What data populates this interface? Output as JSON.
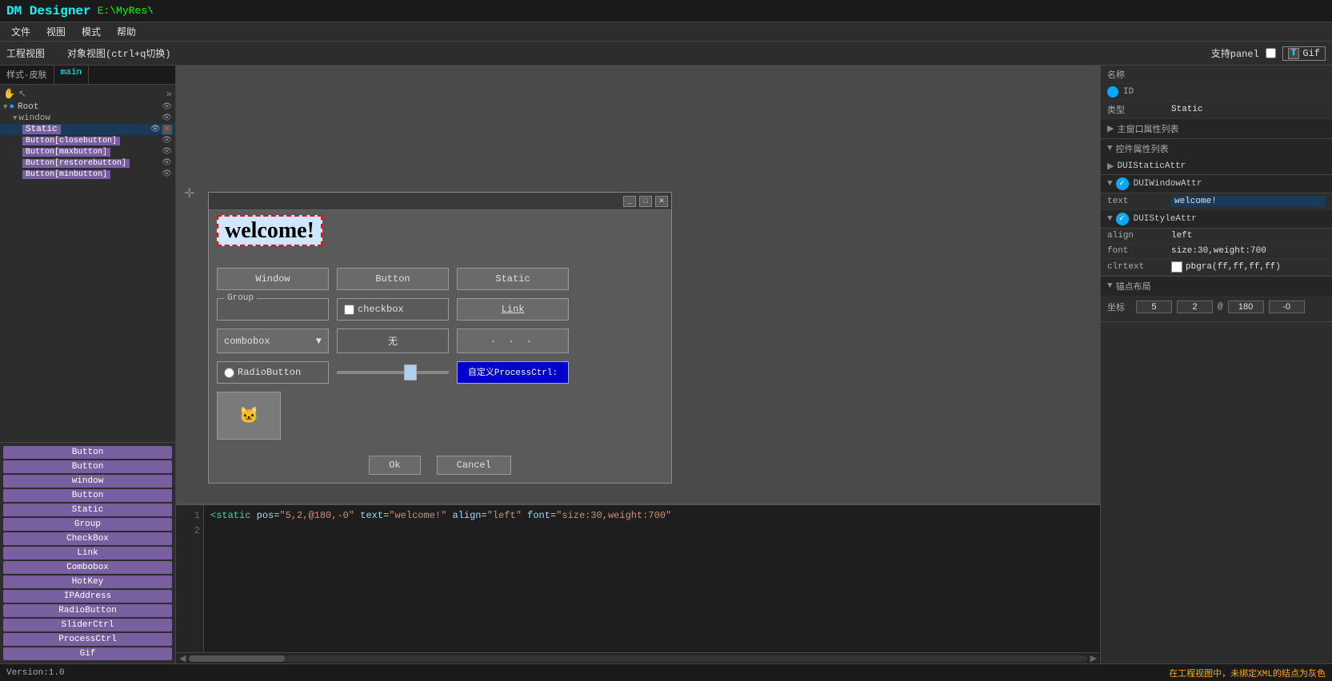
{
  "titleBar": {
    "appName": "DM Designer",
    "path": "E:\\MyRes\\"
  },
  "menuBar": {
    "items": [
      "文件",
      "视图",
      "模式",
      "帮助"
    ]
  },
  "toolbar": {
    "leftLabel": "工程视图",
    "middleLabel": "对象视图(ctrl+q切换)",
    "rightLabel": "支持panel",
    "gifLabel": "Gif"
  },
  "leftPanel": {
    "tabs": [
      "样式-皮肤",
      "main"
    ],
    "tree": {
      "items": [
        {
          "label": "Root",
          "level": 0,
          "expanded": true
        },
        {
          "label": "window",
          "level": 1,
          "expanded": true
        },
        {
          "label": "Static",
          "level": 2,
          "selected": true
        },
        {
          "label": "Button[closebutton]",
          "level": 2
        },
        {
          "label": "Button[maxbutton]",
          "level": 2
        },
        {
          "label": "Button[restorebutton]",
          "level": 2
        },
        {
          "label": "Button[minbutton]",
          "level": 2
        }
      ]
    }
  },
  "componentList": {
    "items": [
      "Button",
      "Button",
      "window",
      "Button",
      "Static",
      "Group",
      "CheckBox",
      "Link",
      "Combobox",
      "HotKey",
      "IPAddress",
      "RadioButton",
      "SliderCtrl",
      "ProcessCtrl",
      "Gif"
    ]
  },
  "canvas": {
    "dialog": {
      "welcomeText": "welcome!",
      "widgets": {
        "window": "Window",
        "button": "Button",
        "static": "Static",
        "group": "Group",
        "checkbox": "checkbox",
        "link": "Link",
        "combobox": "combobox",
        "wu": "无",
        "dots": ". . .",
        "radio": "RadioButton",
        "process": "自定义ProcessCtrl:"
      },
      "footer": {
        "ok": "Ok",
        "cancel": "Cancel"
      }
    }
  },
  "codeEditor": {
    "lines": [
      "1",
      "2"
    ],
    "code": "<static pos=\"5,2,@180,-0\" text=\"welcome!\" align=\"left\" font=\"size:30,weight:700\""
  },
  "rightPanel": {
    "name": {
      "label": "名称",
      "value": ""
    },
    "id": {
      "label": "ID",
      "value": ""
    },
    "type": {
      "label": "类型",
      "value": "Static"
    },
    "mainWindowProps": {
      "title": "主窗口属性列表"
    },
    "controlProps": {
      "title": "控件属性列表",
      "sections": [
        {
          "name": "DUIStaticAttr",
          "expanded": true
        },
        {
          "name": "DUIWindowAttr",
          "expanded": true,
          "props": [
            {
              "label": "text",
              "value": "welcome!"
            }
          ]
        },
        {
          "name": "DUIStyleAttr",
          "expanded": true,
          "props": [
            {
              "label": "align",
              "value": "left"
            },
            {
              "label": "font",
              "value": "size:30,weight:700"
            },
            {
              "label": "clrtext",
              "value": "pbgra(ff,ff,ff,ff)",
              "hasColor": true,
              "colorHex": "#ffffff"
            }
          ]
        }
      ]
    },
    "anchorLayout": {
      "title": "锚点布局",
      "coordLabel": "坐标",
      "coords": [
        "5",
        "2",
        "@180",
        "-0"
      ]
    }
  },
  "statusBar": {
    "version": "Version:1.0",
    "message": "在工程视图中，未绑定XML的结点为灰色"
  }
}
